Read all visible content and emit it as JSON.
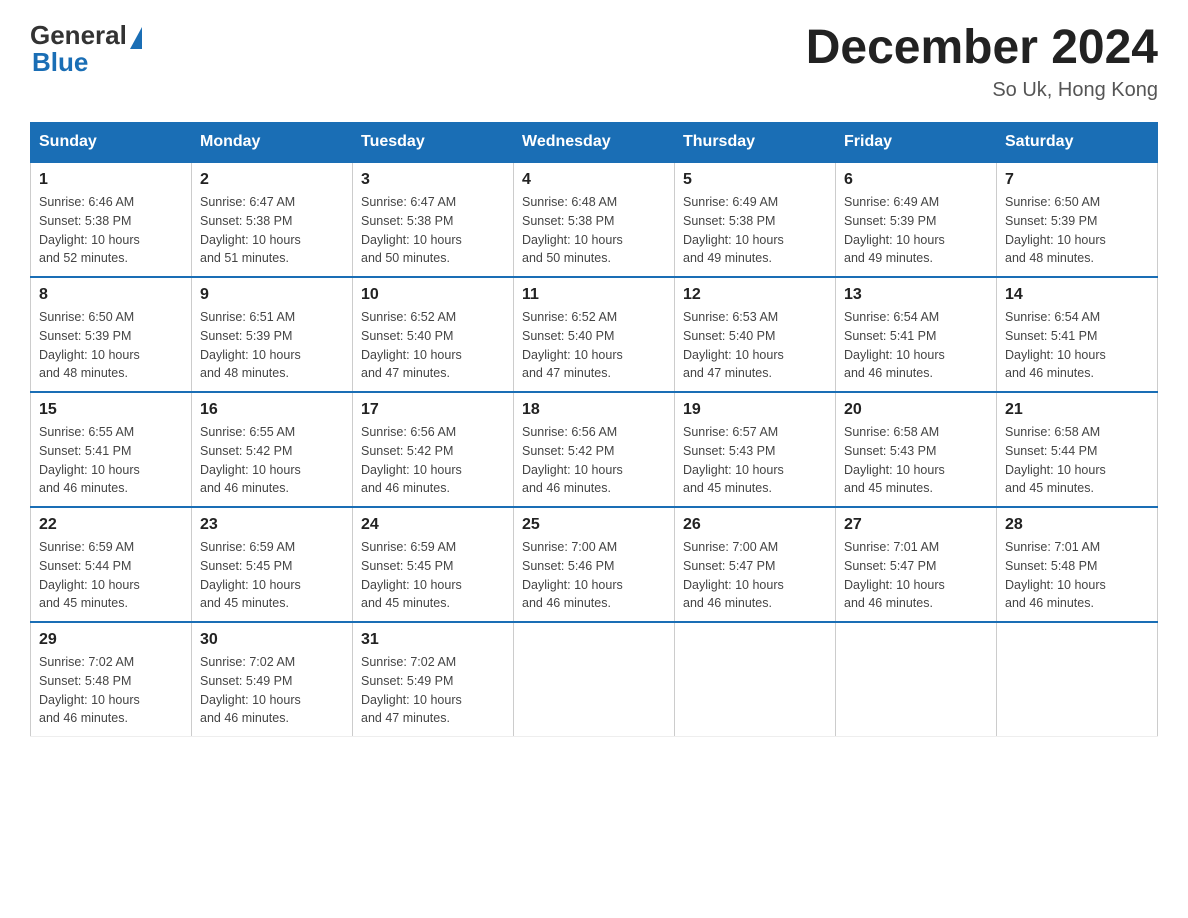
{
  "logo": {
    "general": "General",
    "blue": "Blue"
  },
  "header": {
    "title": "December 2024",
    "subtitle": "So Uk, Hong Kong"
  },
  "days_of_week": [
    "Sunday",
    "Monday",
    "Tuesday",
    "Wednesday",
    "Thursday",
    "Friday",
    "Saturday"
  ],
  "weeks": [
    [
      {
        "day": "1",
        "sunrise": "6:46 AM",
        "sunset": "5:38 PM",
        "daylight": "10 hours and 52 minutes."
      },
      {
        "day": "2",
        "sunrise": "6:47 AM",
        "sunset": "5:38 PM",
        "daylight": "10 hours and 51 minutes."
      },
      {
        "day": "3",
        "sunrise": "6:47 AM",
        "sunset": "5:38 PM",
        "daylight": "10 hours and 50 minutes."
      },
      {
        "day": "4",
        "sunrise": "6:48 AM",
        "sunset": "5:38 PM",
        "daylight": "10 hours and 50 minutes."
      },
      {
        "day": "5",
        "sunrise": "6:49 AM",
        "sunset": "5:38 PM",
        "daylight": "10 hours and 49 minutes."
      },
      {
        "day": "6",
        "sunrise": "6:49 AM",
        "sunset": "5:39 PM",
        "daylight": "10 hours and 49 minutes."
      },
      {
        "day": "7",
        "sunrise": "6:50 AM",
        "sunset": "5:39 PM",
        "daylight": "10 hours and 48 minutes."
      }
    ],
    [
      {
        "day": "8",
        "sunrise": "6:50 AM",
        "sunset": "5:39 PM",
        "daylight": "10 hours and 48 minutes."
      },
      {
        "day": "9",
        "sunrise": "6:51 AM",
        "sunset": "5:39 PM",
        "daylight": "10 hours and 48 minutes."
      },
      {
        "day": "10",
        "sunrise": "6:52 AM",
        "sunset": "5:40 PM",
        "daylight": "10 hours and 47 minutes."
      },
      {
        "day": "11",
        "sunrise": "6:52 AM",
        "sunset": "5:40 PM",
        "daylight": "10 hours and 47 minutes."
      },
      {
        "day": "12",
        "sunrise": "6:53 AM",
        "sunset": "5:40 PM",
        "daylight": "10 hours and 47 minutes."
      },
      {
        "day": "13",
        "sunrise": "6:54 AM",
        "sunset": "5:41 PM",
        "daylight": "10 hours and 46 minutes."
      },
      {
        "day": "14",
        "sunrise": "6:54 AM",
        "sunset": "5:41 PM",
        "daylight": "10 hours and 46 minutes."
      }
    ],
    [
      {
        "day": "15",
        "sunrise": "6:55 AM",
        "sunset": "5:41 PM",
        "daylight": "10 hours and 46 minutes."
      },
      {
        "day": "16",
        "sunrise": "6:55 AM",
        "sunset": "5:42 PM",
        "daylight": "10 hours and 46 minutes."
      },
      {
        "day": "17",
        "sunrise": "6:56 AM",
        "sunset": "5:42 PM",
        "daylight": "10 hours and 46 minutes."
      },
      {
        "day": "18",
        "sunrise": "6:56 AM",
        "sunset": "5:42 PM",
        "daylight": "10 hours and 46 minutes."
      },
      {
        "day": "19",
        "sunrise": "6:57 AM",
        "sunset": "5:43 PM",
        "daylight": "10 hours and 45 minutes."
      },
      {
        "day": "20",
        "sunrise": "6:58 AM",
        "sunset": "5:43 PM",
        "daylight": "10 hours and 45 minutes."
      },
      {
        "day": "21",
        "sunrise": "6:58 AM",
        "sunset": "5:44 PM",
        "daylight": "10 hours and 45 minutes."
      }
    ],
    [
      {
        "day": "22",
        "sunrise": "6:59 AM",
        "sunset": "5:44 PM",
        "daylight": "10 hours and 45 minutes."
      },
      {
        "day": "23",
        "sunrise": "6:59 AM",
        "sunset": "5:45 PM",
        "daylight": "10 hours and 45 minutes."
      },
      {
        "day": "24",
        "sunrise": "6:59 AM",
        "sunset": "5:45 PM",
        "daylight": "10 hours and 45 minutes."
      },
      {
        "day": "25",
        "sunrise": "7:00 AM",
        "sunset": "5:46 PM",
        "daylight": "10 hours and 46 minutes."
      },
      {
        "day": "26",
        "sunrise": "7:00 AM",
        "sunset": "5:47 PM",
        "daylight": "10 hours and 46 minutes."
      },
      {
        "day": "27",
        "sunrise": "7:01 AM",
        "sunset": "5:47 PM",
        "daylight": "10 hours and 46 minutes."
      },
      {
        "day": "28",
        "sunrise": "7:01 AM",
        "sunset": "5:48 PM",
        "daylight": "10 hours and 46 minutes."
      }
    ],
    [
      {
        "day": "29",
        "sunrise": "7:02 AM",
        "sunset": "5:48 PM",
        "daylight": "10 hours and 46 minutes."
      },
      {
        "day": "30",
        "sunrise": "7:02 AM",
        "sunset": "5:49 PM",
        "daylight": "10 hours and 46 minutes."
      },
      {
        "day": "31",
        "sunrise": "7:02 AM",
        "sunset": "5:49 PM",
        "daylight": "10 hours and 47 minutes."
      },
      null,
      null,
      null,
      null
    ]
  ],
  "labels": {
    "sunrise": "Sunrise:",
    "sunset": "Sunset:",
    "daylight": "Daylight:"
  }
}
